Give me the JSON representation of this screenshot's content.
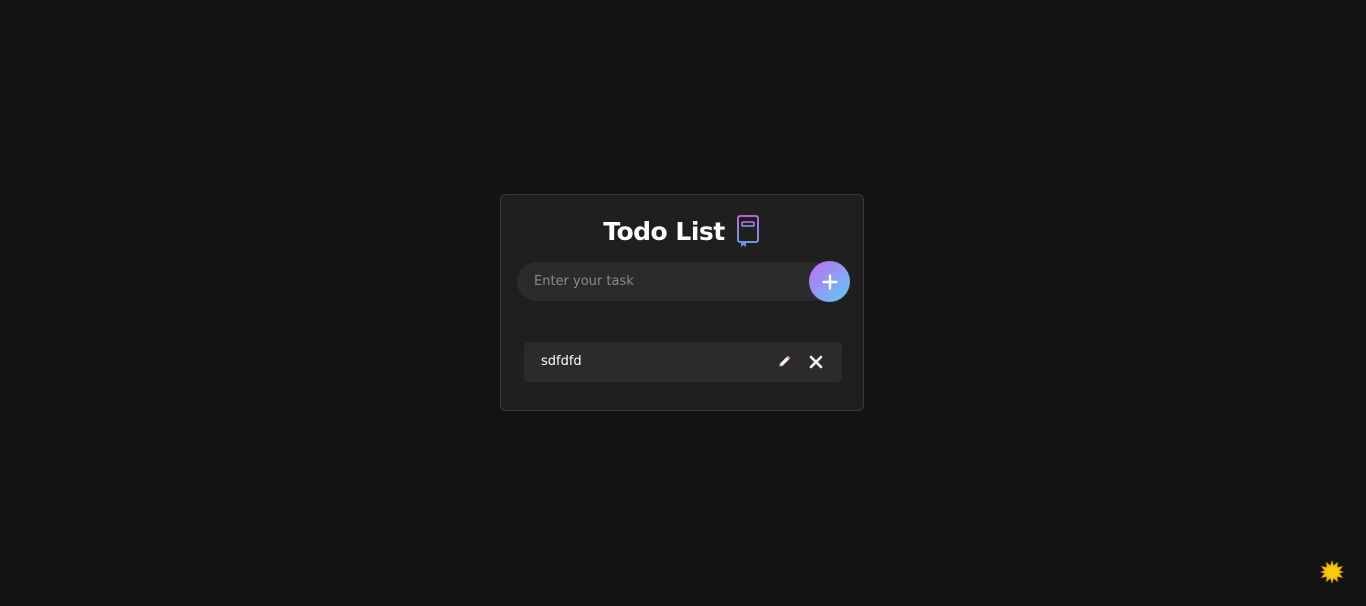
{
  "header": {
    "title": "Todo List",
    "icon": "notebook-icon"
  },
  "input": {
    "value": "",
    "placeholder": "Enter your task",
    "add_icon": "plus-icon"
  },
  "tasks": [
    {
      "text": "sdfdfd",
      "edit_icon": "pencil-icon",
      "delete_icon": "close-icon"
    }
  ],
  "theme_toggle": {
    "icon": "sun-icon"
  },
  "colors": {
    "background": "#131313",
    "card": "#1f1f20",
    "field": "#2b2b2d",
    "accent_start": "#c06cf0",
    "accent_end": "#5ad0ee",
    "sun": "#f5c400"
  }
}
